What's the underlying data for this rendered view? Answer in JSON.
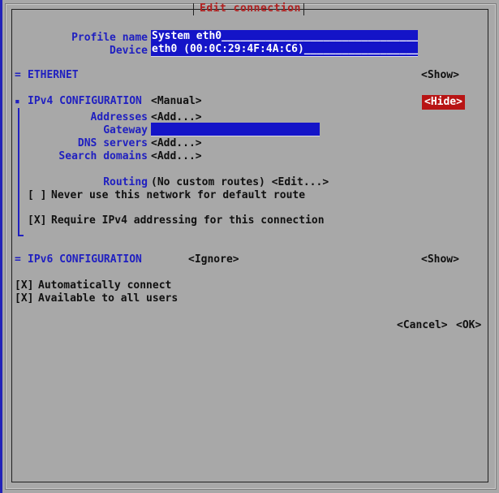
{
  "dialog": {
    "title": "Edit connection"
  },
  "header_fields": [
    {
      "label": "Profile name",
      "value": "System eth0"
    },
    {
      "label": "Device",
      "value": "eth0 (00:0C:29:4F:4A:C6)"
    }
  ],
  "ethernet_section": {
    "marker": "=",
    "name": "ETHERNET",
    "toggle": "<Show>"
  },
  "ipv4_section": {
    "marker": "▪",
    "name": "IPv4 CONFIGURATION",
    "method": "<Manual>",
    "toggle": "<Hide>",
    "fields": [
      {
        "label": "Addresses",
        "value": "<Add...>"
      },
      {
        "label": "Gateway",
        "value": ""
      },
      {
        "label": "DNS servers",
        "value": "<Add...>"
      },
      {
        "label": "Search domains",
        "value": "<Add...>"
      }
    ],
    "routing": {
      "label": "Routing",
      "value": "(No custom routes) <Edit...>"
    },
    "checkboxes": [
      {
        "box": "[ ]",
        "label": "Never use this network for default route"
      },
      {
        "box": "[X]",
        "label": "Require IPv4 addressing for this connection"
      }
    ]
  },
  "ipv6_section": {
    "marker": "=",
    "name": "IPv6 CONFIGURATION",
    "method": "<Ignore>",
    "toggle": "<Show>"
  },
  "connection_options": [
    {
      "box": "[X]",
      "label": "Automatically connect"
    },
    {
      "box": "[X]",
      "label": "Available to all users"
    }
  ],
  "actions": {
    "cancel": "<Cancel>",
    "ok": "<OK>"
  },
  "colors": {
    "background": "#a8a8a8",
    "label_blue": "#2020c0",
    "field_blue": "#1414c8",
    "focus_red": "#b81414",
    "title_red": "#b02020"
  }
}
